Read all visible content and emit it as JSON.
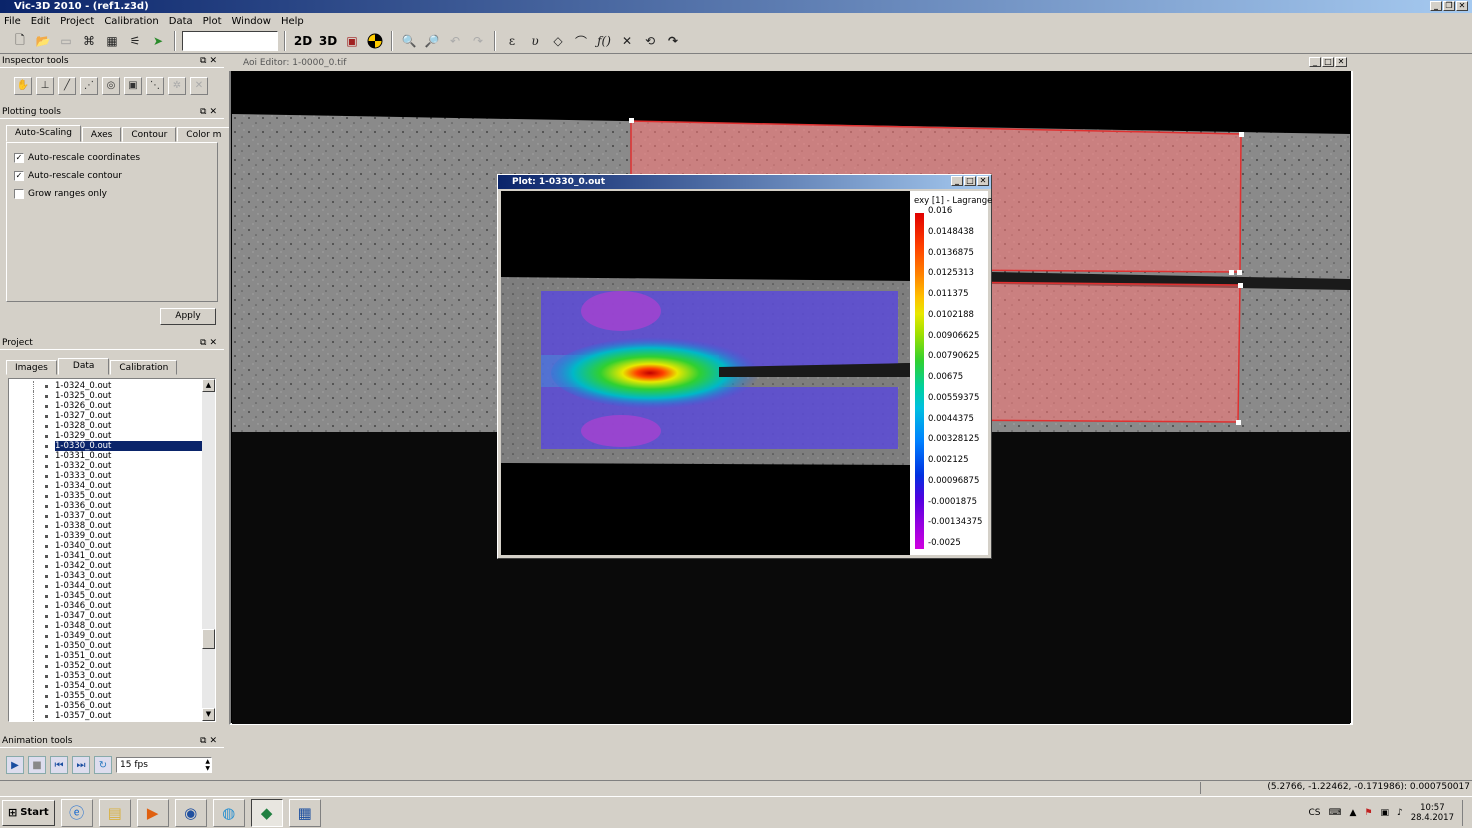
{
  "window": {
    "title": "Vic-3D 2010 - (ref1.z3d)"
  },
  "menu": [
    "File",
    "Edit",
    "Project",
    "Calibration",
    "Data",
    "Plot",
    "Window",
    "Help"
  ],
  "toolbar": {
    "label_2d": "2D",
    "label_3d": "3D"
  },
  "inspector": {
    "title": "Inspector tools"
  },
  "plotting": {
    "title": "Plotting tools",
    "tabs": [
      "Auto-Scaling",
      "Axes",
      "Contour",
      "Color m"
    ],
    "checks": [
      {
        "label": "Auto-rescale coordinates",
        "checked": true
      },
      {
        "label": "Auto-rescale contour",
        "checked": true
      },
      {
        "label": "Grow ranges only",
        "checked": false
      }
    ],
    "apply": "Apply"
  },
  "project": {
    "title": "Project",
    "tabs": [
      "Images",
      "Data",
      "Calibration"
    ],
    "files": [
      "1-0324_0.out",
      "1-0325_0.out",
      "1-0326_0.out",
      "1-0327_0.out",
      "1-0328_0.out",
      "1-0329_0.out",
      "1-0330_0.out",
      "1-0331_0.out",
      "1-0332_0.out",
      "1-0333_0.out",
      "1-0334_0.out",
      "1-0335_0.out",
      "1-0336_0.out",
      "1-0337_0.out",
      "1-0338_0.out",
      "1-0339_0.out",
      "1-0340_0.out",
      "1-0341_0.out",
      "1-0342_0.out",
      "1-0343_0.out",
      "1-0344_0.out",
      "1-0345_0.out",
      "1-0346_0.out",
      "1-0347_0.out",
      "1-0348_0.out",
      "1-0349_0.out",
      "1-0350_0.out",
      "1-0351_0.out",
      "1-0352_0.out",
      "1-0353_0.out",
      "1-0354_0.out",
      "1-0355_0.out",
      "1-0356_0.out",
      "1-0357_0.out"
    ],
    "selected": "1-0330_0.out"
  },
  "animation": {
    "title": "Animation tools",
    "fps": "15 fps"
  },
  "aoi": {
    "title": "Aoi Editor: 1-0000_0.tif"
  },
  "plot": {
    "title": "Plot: 1-0330_0.out",
    "legend_title": "exy [1] - Lagrange",
    "legend_values": [
      "0.016",
      "0.0148438",
      "0.0136875",
      "0.0125313",
      "0.011375",
      "0.0102188",
      "0.00906625",
      "0.00790625",
      "0.00675",
      "0.00559375",
      "0.0044375",
      "0.00328125",
      "0.002125",
      "0.00096875",
      "-0.0001875",
      "-0.00134375",
      "-0.0025"
    ]
  },
  "status": {
    "coords": "(5.2766, -1.22462, -0.171986): 0.000750017"
  },
  "taskbar": {
    "start": "Start",
    "lang": "CS",
    "time": "10:57",
    "date": "28.4.2017"
  }
}
